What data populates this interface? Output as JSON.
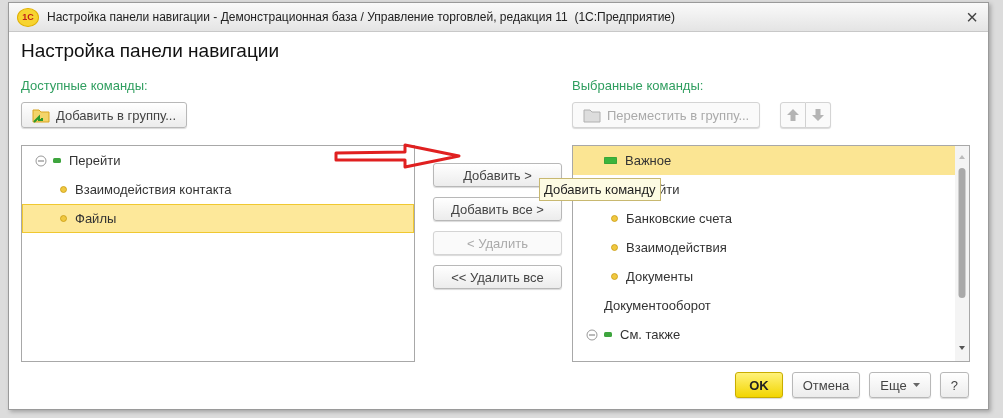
{
  "window": {
    "logo": "1С",
    "title": "Настройка панели навигации - Демонстрационная база / Управление торговлей, редакция 11  (1С:Предприятие)",
    "close": "×"
  },
  "heading": "Настройка панели навигации",
  "available": {
    "label": "Доступные команды:",
    "toolbar": [
      {
        "kind": "add-group",
        "label": "Добавить в группу...",
        "disabled": false
      }
    ],
    "focused": true,
    "items": [
      {
        "kind": "group",
        "label": "Перейти",
        "expanded": true,
        "selected": false,
        "children": [
          {
            "kind": "command",
            "label": "Взаимодействия контакта",
            "selected": false
          },
          {
            "kind": "command",
            "label": "Файлы",
            "selected": true
          }
        ]
      }
    ]
  },
  "transfer_buttons": [
    {
      "label": "Добавить >",
      "disabled": false
    },
    {
      "label": "Добавить все >",
      "disabled": false
    },
    {
      "label": "< Удалить",
      "disabled": true
    },
    {
      "label": "<< Удалить все",
      "disabled": false
    }
  ],
  "tooltip": "Добавить команду",
  "selected_commands": {
    "label": "Выбранные команды:",
    "toolbar": [
      {
        "kind": "move-group",
        "label": "Переместить в группу...",
        "disabled": true
      },
      {
        "kind": "up",
        "disabled": true
      },
      {
        "kind": "down",
        "disabled": true
      }
    ],
    "focused": false,
    "items": [
      {
        "kind": "important",
        "label": "Важное",
        "selected": true
      },
      {
        "kind": "hidden-group",
        "label": "йти",
        "selected": false,
        "children": [
          {
            "kind": "command",
            "label": "Банковские счета",
            "selected": false
          },
          {
            "kind": "command",
            "label": "Взаимодействия",
            "selected": false
          },
          {
            "kind": "command",
            "label": "Документы",
            "selected": false
          }
        ]
      },
      {
        "kind": "plain",
        "label": "Документооборот",
        "selected": false
      },
      {
        "kind": "group",
        "label": "См. также",
        "expanded": true,
        "selected": false
      }
    ]
  },
  "footer_buttons": [
    {
      "kind": "default",
      "label": "OK"
    },
    {
      "kind": "normal",
      "label": "Отмена"
    },
    {
      "kind": "menu",
      "label": "Еще"
    },
    {
      "kind": "normal",
      "label": "?"
    }
  ]
}
